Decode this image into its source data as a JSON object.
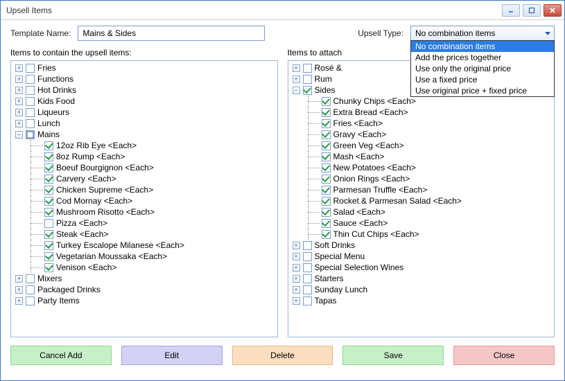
{
  "window": {
    "title": "Upsell Items"
  },
  "labels": {
    "template_name": "Template Name:",
    "upsell_type": "Upsell Type:",
    "left_panel": "Items to contain the upsell items:",
    "right_panel": "Items to attach"
  },
  "template_name_value": "Mains & Sides",
  "upsell_type": {
    "selected": "No combination items",
    "options": [
      "No combination items",
      "Add the prices together",
      "Use only the original price",
      "Use a fixed price",
      "Use original price + fixed price"
    ]
  },
  "left_tree": [
    {
      "label": "Fries",
      "state": "unchecked",
      "expanded": false
    },
    {
      "label": "Functions",
      "state": "unchecked",
      "expanded": false
    },
    {
      "label": "Hot Drinks",
      "state": "unchecked",
      "expanded": false
    },
    {
      "label": "Kids Food",
      "state": "unchecked",
      "expanded": false
    },
    {
      "label": "Liqueurs",
      "state": "unchecked",
      "expanded": false
    },
    {
      "label": "Lunch",
      "state": "unchecked",
      "expanded": false
    },
    {
      "label": "Mains",
      "state": "indet",
      "expanded": true,
      "children": [
        {
          "label": "12oz Rib Eye <Each>",
          "state": "checked"
        },
        {
          "label": "8oz Rump <Each>",
          "state": "checked"
        },
        {
          "label": "Boeuf Bourgignon <Each>",
          "state": "checked"
        },
        {
          "label": "Carvery <Each>",
          "state": "checked"
        },
        {
          "label": "Chicken Supreme <Each>",
          "state": "checked"
        },
        {
          "label": "Cod Mornay <Each>",
          "state": "checked"
        },
        {
          "label": "Mushroom Risotto <Each>",
          "state": "checked"
        },
        {
          "label": "Pizza <Each>",
          "state": "unchecked"
        },
        {
          "label": "Steak <Each>",
          "state": "checked"
        },
        {
          "label": "Turkey Escalope Milanese <Each>",
          "state": "checked"
        },
        {
          "label": "Vegetarian Moussaka <Each>",
          "state": "checked"
        },
        {
          "label": "Venison <Each>",
          "state": "checked"
        }
      ]
    },
    {
      "label": "Mixers",
      "state": "unchecked",
      "expanded": false
    },
    {
      "label": "Packaged Drinks",
      "state": "unchecked",
      "expanded": false
    },
    {
      "label": "Party Items",
      "state": "unchecked",
      "expanded": false
    }
  ],
  "right_tree": [
    {
      "label": "Rosé &",
      "state": "unchecked",
      "expanded": false
    },
    {
      "label": "Rum",
      "state": "unchecked",
      "expanded": false
    },
    {
      "label": "Sides",
      "state": "checked",
      "expanded": true,
      "children": [
        {
          "label": "Chunky Chips <Each>",
          "state": "checked"
        },
        {
          "label": "Extra Bread <Each>",
          "state": "checked"
        },
        {
          "label": "Fries <Each>",
          "state": "checked"
        },
        {
          "label": "Gravy <Each>",
          "state": "checked"
        },
        {
          "label": "Green Veg <Each>",
          "state": "checked"
        },
        {
          "label": "Mash <Each>",
          "state": "checked"
        },
        {
          "label": "New Potatoes <Each>",
          "state": "checked"
        },
        {
          "label": "Onion Rings <Each>",
          "state": "checked"
        },
        {
          "label": "Parmesan Truffle <Each>",
          "state": "checked"
        },
        {
          "label": "Rocket & Parmesan Salad <Each>",
          "state": "checked"
        },
        {
          "label": "Salad <Each>",
          "state": "checked"
        },
        {
          "label": "Sauce <Each>",
          "state": "checked"
        },
        {
          "label": "Thin Cut Chips <Each>",
          "state": "checked"
        }
      ]
    },
    {
      "label": "Soft Drinks",
      "state": "unchecked",
      "expanded": false
    },
    {
      "label": "Special Menu",
      "state": "unchecked",
      "expanded": false
    },
    {
      "label": "Special Selection Wines",
      "state": "unchecked",
      "expanded": false
    },
    {
      "label": "Starters",
      "state": "unchecked",
      "expanded": false
    },
    {
      "label": "Sunday Lunch",
      "state": "unchecked",
      "expanded": false
    },
    {
      "label": "Tapas",
      "state": "unchecked",
      "expanded": false
    }
  ],
  "buttons": {
    "cancel_add": "Cancel Add",
    "edit": "Edit",
    "delete": "Delete",
    "save": "Save",
    "close": "Close"
  }
}
